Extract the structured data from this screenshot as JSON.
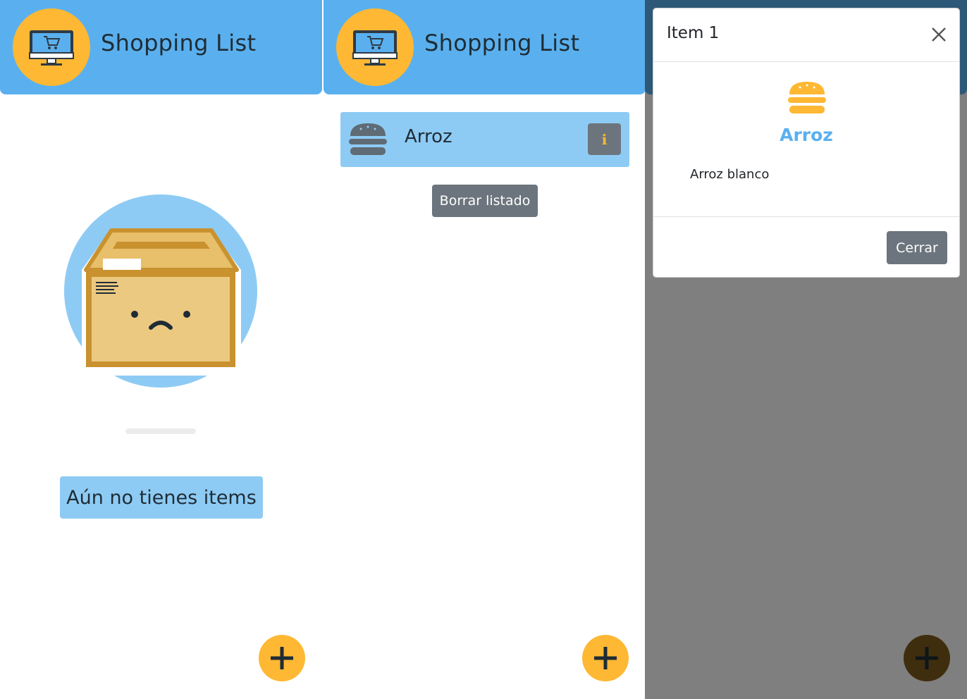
{
  "app": {
    "title": "Shopping List"
  },
  "screen_empty": {
    "empty_message": "Aún no tienes items"
  },
  "screen_list": {
    "items": [
      {
        "name": "Arroz",
        "icon": "burger-icon",
        "info_icon": "info-icon"
      }
    ],
    "clear_label": "Borrar listado"
  },
  "screen_modal": {
    "title": "Item 1",
    "item_name": "Arroz",
    "item_description": "Arroz blanco",
    "close_label": "Cerrar",
    "close_icon": "close-icon"
  },
  "fab": {
    "icon": "plus-icon"
  },
  "colors": {
    "header": "#5ab0ee",
    "accent": "#ffb833",
    "item_bg": "#8ecbf4",
    "secondary_button": "#6c757d",
    "text": "#1f2c35"
  }
}
